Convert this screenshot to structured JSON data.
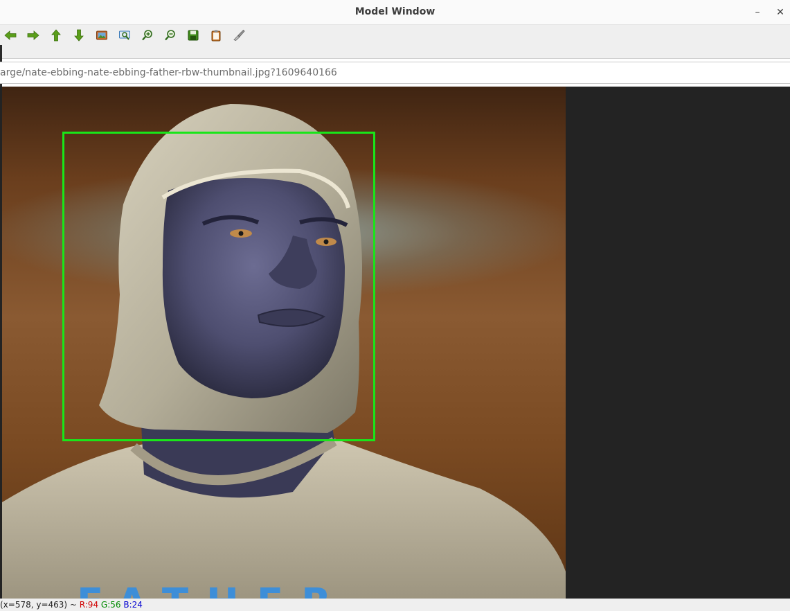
{
  "window": {
    "title": "Model Window",
    "minimize_glyph": "–",
    "close_glyph": "✕"
  },
  "toolbar": {
    "tools": [
      {
        "icon": "arrow-left-icon",
        "color": "#4e9a06"
      },
      {
        "icon": "arrow-right-icon",
        "color": "#4e9a06"
      },
      {
        "icon": "arrow-up-icon",
        "color": "#4e9a06"
      },
      {
        "icon": "arrow-down-icon",
        "color": "#4e9a06"
      },
      {
        "icon": "image-icon",
        "color": "#c05020"
      },
      {
        "icon": "zoom-fit-icon",
        "color": "#3a7ab8"
      },
      {
        "icon": "zoom-in-icon",
        "color": "#4e9a06"
      },
      {
        "icon": "zoom-out-icon",
        "color": "#4e9a06"
      },
      {
        "icon": "save-icon",
        "color": "#2e7d12"
      },
      {
        "icon": "clipboard-icon",
        "color": "#b8651b"
      },
      {
        "icon": "brush-icon",
        "color": "#8a8a8a"
      }
    ]
  },
  "url": {
    "value": "arge/nate-ebbing-nate-ebbing-father-rbw-thumbnail.jpg?1609640166"
  },
  "image": {
    "overlay_text": "FATHER",
    "box_color": "#19e619"
  },
  "status": {
    "coords": "(x=578, y=463) ~ ",
    "r": "R:94",
    "g": "G:56",
    "b": "B:24"
  }
}
